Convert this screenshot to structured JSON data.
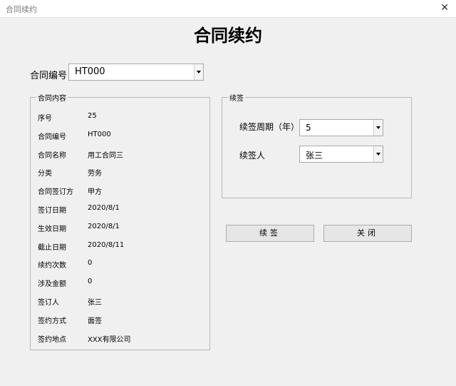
{
  "window": {
    "title": "合同续约"
  },
  "heading": "合同续约",
  "contract_no": {
    "label": "合同编号",
    "value": "HT000"
  },
  "content_group": {
    "title": "合同内容",
    "rows": [
      {
        "label": "序号",
        "value": "25"
      },
      {
        "label": "合同编号",
        "value": "HT000"
      },
      {
        "label": "合同名称",
        "value": "用工合同三"
      },
      {
        "label": "分类",
        "value": "劳务"
      },
      {
        "label": "合同签订方",
        "value": "甲方"
      },
      {
        "label": "签订日期",
        "value": "2020/8/1"
      },
      {
        "label": "生效日期",
        "value": "2020/8/1"
      },
      {
        "label": "截止日期",
        "value": "2020/8/11"
      },
      {
        "label": "续约次数",
        "value": "0"
      },
      {
        "label": "涉及金额",
        "value": "0"
      },
      {
        "label": "签订人",
        "value": "张三"
      },
      {
        "label": "签约方式",
        "value": "面签"
      },
      {
        "label": "签约地点",
        "value": "XXX有限公司"
      }
    ]
  },
  "renew_group": {
    "title": "续签",
    "period": {
      "label": "续签周期（年）",
      "value": "5"
    },
    "person": {
      "label": "续签人",
      "value": "张三"
    }
  },
  "buttons": {
    "renew": "续签",
    "close": "关闭"
  }
}
